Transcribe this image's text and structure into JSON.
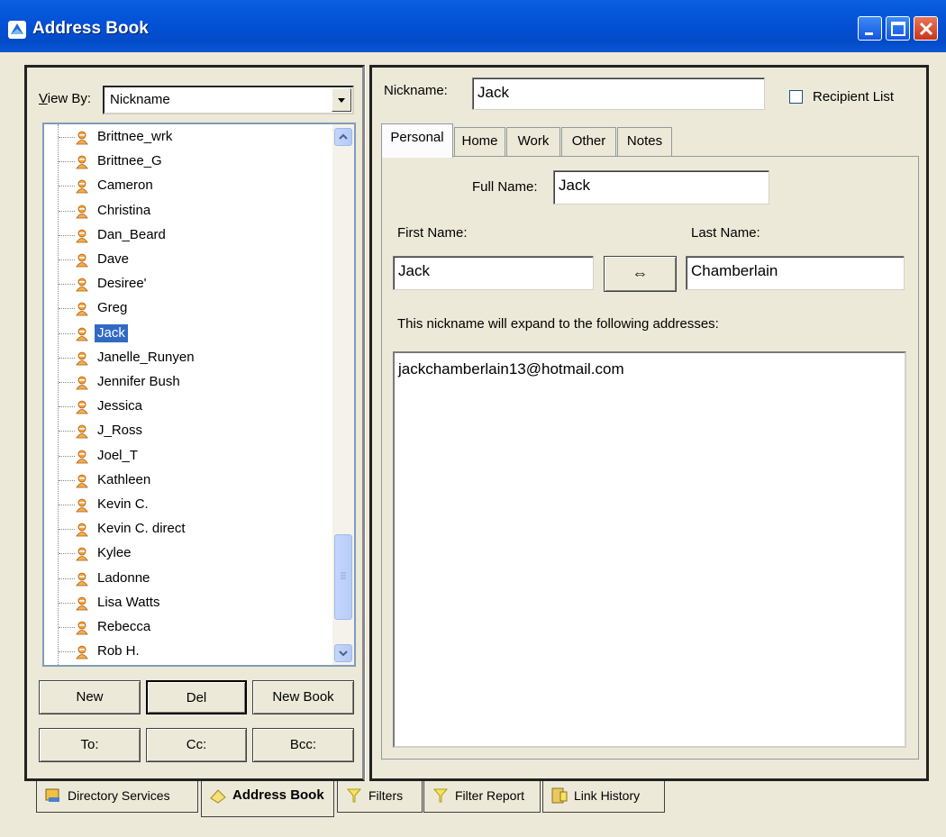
{
  "window": {
    "title": "Address Book"
  },
  "left": {
    "view_by_label": "View By:",
    "view_by_value": "Nickname",
    "list": [
      "Brittnee_wrk",
      "Brittnee_G",
      "Cameron",
      "Christina",
      "Dan_Beard",
      "Dave",
      "Desiree'",
      "Greg",
      "Jack",
      "Janelle_Runyen",
      "Jennifer Bush",
      "Jessica",
      "J_Ross",
      "Joel_T",
      "Kathleen",
      "Kevin C.",
      "Kevin C. direct",
      "Kylee",
      "Ladonne",
      "Lisa Watts",
      "Rebecca",
      "Rob H."
    ],
    "selected": "Jack",
    "buttons": {
      "new": "New",
      "del": "Del",
      "new_book": "New Book",
      "to": "To:",
      "cc": "Cc:",
      "bcc": "Bcc:"
    }
  },
  "right": {
    "nickname_label": "Nickname:",
    "nickname_value": "Jack",
    "recipient_list_label": "Recipient List",
    "recipient_list_checked": false,
    "tabs": [
      "Personal",
      "Home",
      "Work",
      "Other",
      "Notes"
    ],
    "active_tab": "Personal",
    "full_name_label": "Full Name:",
    "full_name_value": "Jack",
    "first_name_label": "First Name:",
    "first_name_value": "Jack",
    "last_name_label": "Last Name:",
    "last_name_value": "Chamberlain",
    "swap_button": "⇔",
    "expand_label": "This nickname will expand to the following addresses:",
    "addresses": [
      "jackchamberlain13@hotmail.com"
    ]
  },
  "bottom_tabs": [
    "Directory Services",
    "Address Book",
    "Filters",
    "Filter Report",
    "Link History"
  ],
  "active_bottom_tab": "Address Book"
}
